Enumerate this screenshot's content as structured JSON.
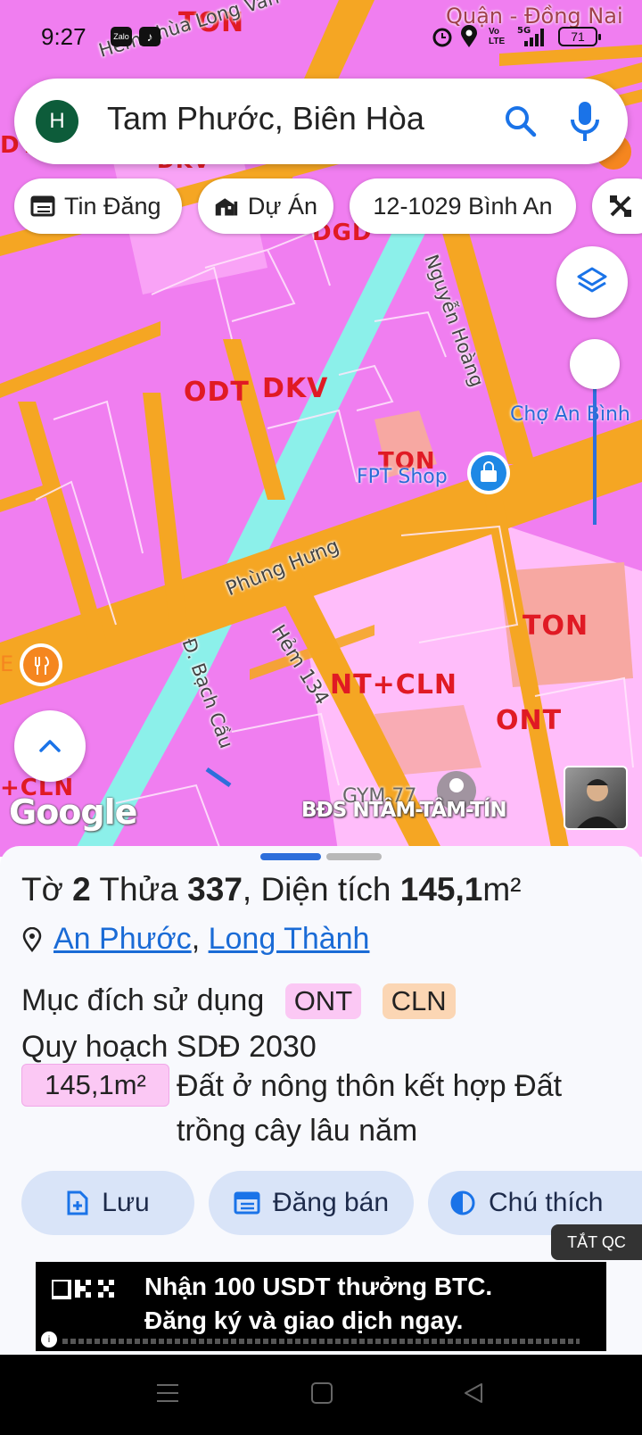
{
  "status_bar": {
    "time": "9:27",
    "left_icons": [
      "zalo-icon",
      "tiktok-icon"
    ],
    "right_icons": [
      "alarm-icon",
      "location-icon",
      "volte-icon",
      "5g-signal-icon",
      "battery-icon"
    ],
    "battery": "71"
  },
  "search": {
    "avatar_letter": "H",
    "query": "Tam Phước, Biên Hòa"
  },
  "chips": [
    {
      "label": "Tin Đăng",
      "icon": "listing-icon"
    },
    {
      "label": "Dự Án",
      "icon": "project-building-icon"
    },
    {
      "label": "12-1029 Bình An",
      "icon": ""
    },
    {
      "label": "",
      "icon": "tools-icon"
    }
  ],
  "map": {
    "zone_labels": [
      "TON",
      "DKV",
      "DGD",
      "ODT",
      "DKV",
      "TON",
      "TON",
      "NT+CLN",
      "ONT",
      "+CLN",
      "DT"
    ],
    "road_labels": [
      "Hẻm chùa Long Vân",
      "Nguyễn Hoàng",
      "Phùng Hưng",
      "Hẻm 134",
      "Đ. Bạch Cầu"
    ],
    "poi_labels": [
      "Chợ An Bình",
      "FPT Shop",
      "GYM 77"
    ],
    "district_label": "Quận - Đồng Nai",
    "google_logo": "Google",
    "watermark": "BĐS NTÂM-TÂM-TÍN",
    "edge_label": "E",
    "colors": {
      "residential": "#f07ef0",
      "light_zone": "#ffbdfa",
      "religious": "#f7a8a2",
      "road": "#f5a623",
      "canal": "#8cf0ea"
    }
  },
  "parcel": {
    "to_label": "Tờ",
    "to_number": "2",
    "thua_label": "Thửa",
    "thua_number": "337",
    "area_label": ", Diện tích",
    "area_value": "145,1",
    "area_unit": "m²",
    "ward": "An Phước",
    "district": "Long Thành",
    "purpose_label": "Mục đích sử dụng",
    "purpose_tags": [
      {
        "code": "ONT",
        "color": "#fbc8f4"
      },
      {
        "code": "CLN",
        "color": "#fbd6b4"
      }
    ],
    "plan_label": "Quy hoạch SDĐ 2030",
    "plan_area": "145,1m²",
    "plan_desc": "Đất ở nông thôn kết hợp Đất trồng cây lâu năm"
  },
  "actions": {
    "save": "Lưu",
    "post_sale": "Đăng bán",
    "legend": "Chú thích"
  },
  "ad": {
    "close_label": "TẮT QC",
    "line1": "Nhận 100 USDT thưởng BTC.",
    "line2": "Đăng ký và giao dịch ngay."
  }
}
